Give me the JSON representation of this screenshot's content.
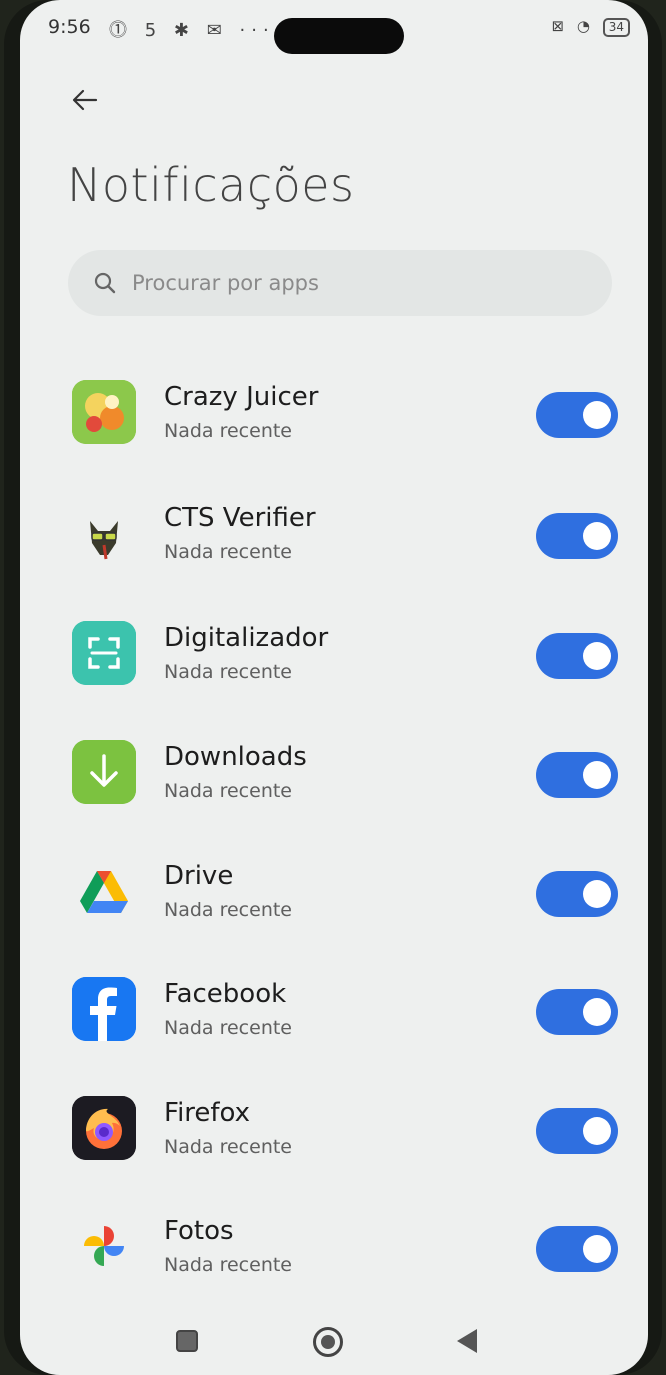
{
  "status_bar": {
    "time": "9:56",
    "left_icons": "⓵ 5 ✱ ✉ ···",
    "battery": "34"
  },
  "page": {
    "title": "Notificações",
    "search_placeholder": "Procurar por apps"
  },
  "apps": [
    {
      "name": "Crazy Juicer",
      "status": "Nada recente",
      "enabled": true,
      "icon": "crazy-juicer-icon"
    },
    {
      "name": "CTS Verifier",
      "status": "Nada recente",
      "enabled": true,
      "icon": "cts-verifier-icon"
    },
    {
      "name": "Digitalizador",
      "status": "Nada recente",
      "enabled": true,
      "icon": "scanner-icon"
    },
    {
      "name": "Downloads",
      "status": "Nada recente",
      "enabled": true,
      "icon": "download-arrow-icon"
    },
    {
      "name": "Drive",
      "status": "Nada recente",
      "enabled": true,
      "icon": "google-drive-icon"
    },
    {
      "name": "Facebook",
      "status": "Nada recente",
      "enabled": true,
      "icon": "facebook-icon"
    },
    {
      "name": "Firefox",
      "status": "Nada recente",
      "enabled": true,
      "icon": "firefox-icon"
    },
    {
      "name": "Fotos",
      "status": "Nada recente",
      "enabled": true,
      "icon": "google-photos-icon"
    }
  ],
  "colors": {
    "toggle_on": "#2f6fe0",
    "background": "#eef0ef"
  }
}
